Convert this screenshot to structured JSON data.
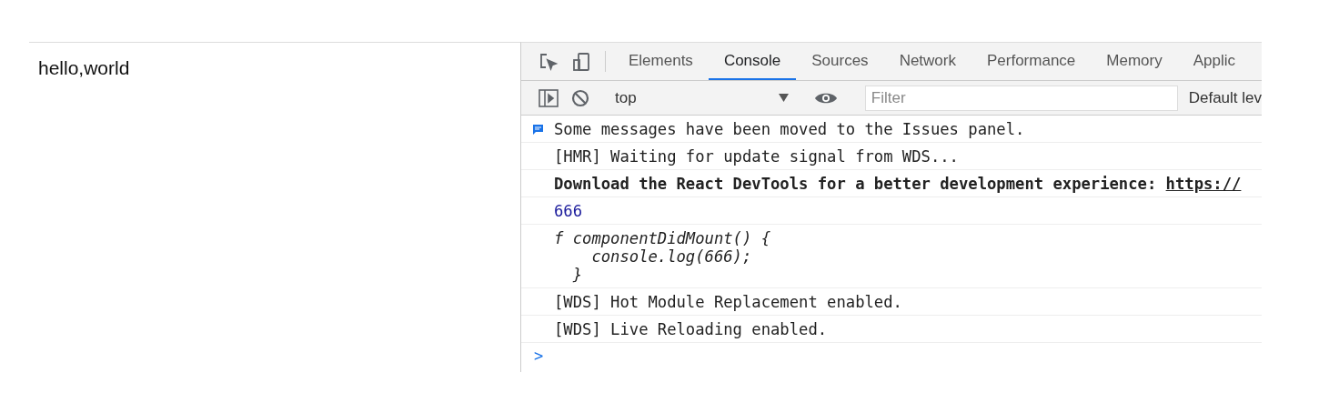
{
  "page": {
    "text": "hello,world"
  },
  "devtools": {
    "tabs": [
      {
        "label": "Elements",
        "selected": false
      },
      {
        "label": "Console",
        "selected": true
      },
      {
        "label": "Sources",
        "selected": false
      },
      {
        "label": "Network",
        "selected": false
      },
      {
        "label": "Performance",
        "selected": false
      },
      {
        "label": "Memory",
        "selected": false
      },
      {
        "label": "Applic",
        "selected": false
      }
    ],
    "toolbar": {
      "context": "top",
      "filter_placeholder": "Filter",
      "levels": "Default lev"
    },
    "messages": [
      {
        "kind": "info",
        "text": "Some messages have been moved to the Issues panel."
      },
      {
        "kind": "log",
        "text": "[HMR] Waiting for update signal from WDS..."
      },
      {
        "kind": "bold",
        "text": "Download the React DevTools for a better development experience: ",
        "link": "https://"
      },
      {
        "kind": "number",
        "text": "666"
      },
      {
        "kind": "function",
        "lines": [
          "f componentDidMount() {",
          "    console.log(666);",
          "  }"
        ]
      },
      {
        "kind": "log",
        "text": "[WDS] Hot Module Replacement enabled."
      },
      {
        "kind": "log",
        "text": "[WDS] Live Reloading enabled."
      }
    ],
    "prompt": ">"
  }
}
